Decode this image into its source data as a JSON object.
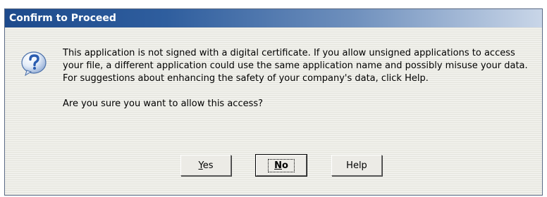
{
  "dialog": {
    "title": "Confirm to Proceed",
    "icon": "question-icon",
    "message": "This application is not signed with a digital certificate.  If you allow unsigned applications to access your file, a different application could use the same application name and possibly misuse your data.  For suggestions about enhancing the safety of your company's data, click Help.",
    "prompt": "Are you sure you want to allow this access?"
  },
  "buttons": {
    "yes": {
      "mnemonic": "Y",
      "rest": "es"
    },
    "no": {
      "mnemonic": "N",
      "rest": "o"
    },
    "help": {
      "label": "Help"
    }
  },
  "colors": {
    "titlebar_start": "#1d4a8c",
    "titlebar_end": "#c9d6e8",
    "dialog_background": "#ecece6",
    "icon_blue": "#2a5cb0"
  }
}
